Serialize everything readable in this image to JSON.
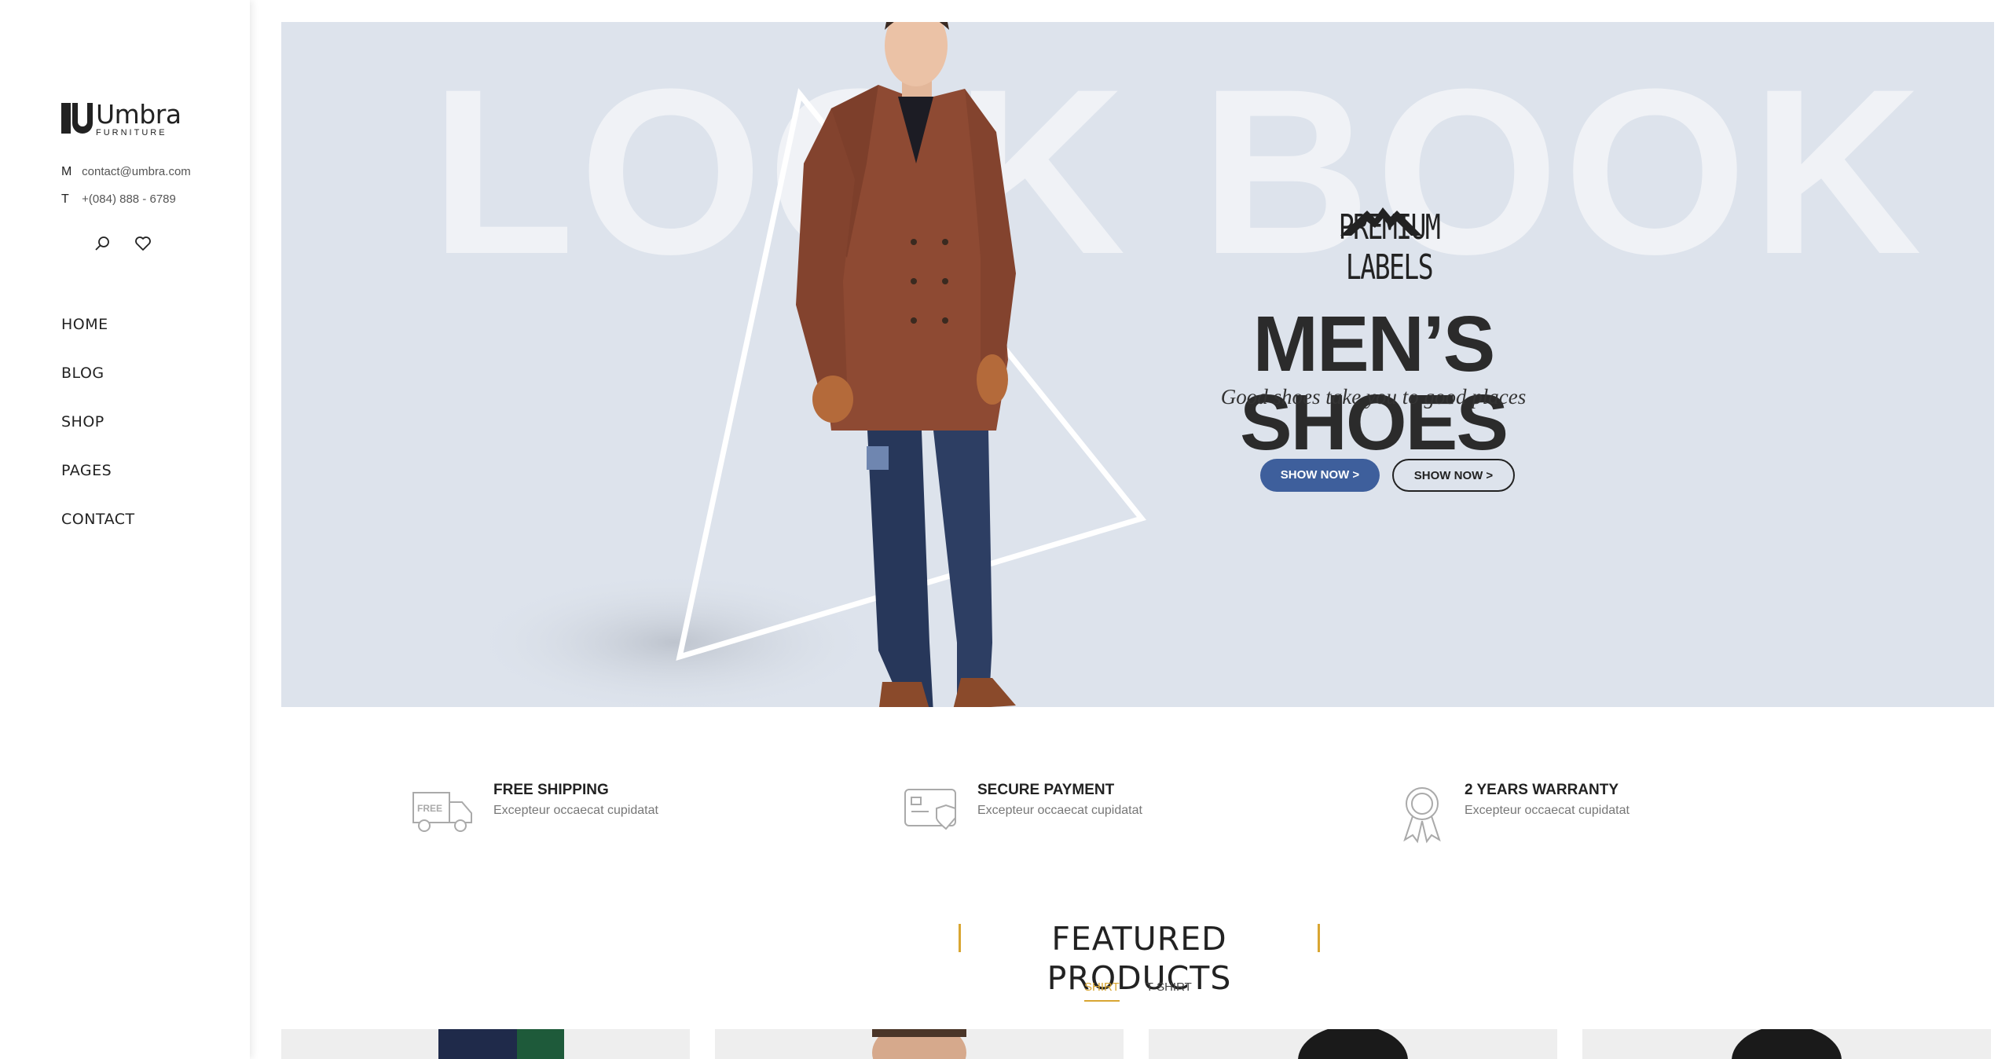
{
  "sidebar": {
    "logo_name": "Umbra",
    "logo_sub": "FURNITURE",
    "contact": {
      "mail_key": "M",
      "mail": "contact@umbra.com",
      "phone_key": "T",
      "phone": "+(084) 888 - 6789"
    },
    "nav": [
      "HOME",
      "BLOG",
      "SHOP",
      "PAGES",
      "CONTACT"
    ]
  },
  "hero": {
    "bg_text": "LOOK BOOK",
    "brand": "PREMIUM LABELS",
    "title": "MEN’S SHOES",
    "subtitle": "Good shoes take you to good places",
    "btn_primary": "SHOW NOW >",
    "btn_secondary": "SHOW NOW >",
    "colors": {
      "background": "#dde3ec",
      "primary_button": "#3e5f9c"
    }
  },
  "features": [
    {
      "icon": "truck-icon",
      "title": "FREE SHIPPING",
      "text": "Excepteur occaecat cupidatat"
    },
    {
      "icon": "credit-card-icon",
      "title": "SECURE PAYMENT",
      "text": "Excepteur occaecat cupidatat"
    },
    {
      "icon": "award-ribbon-icon",
      "title": "2 YEARS WARRANTY",
      "text": "Excepteur occaecat cupidatat"
    }
  ],
  "featured": {
    "title": "FEATURED PRODUCTS",
    "tabs": [
      "SHIRT",
      "T-SHIRT"
    ],
    "accent": "#d9a632"
  }
}
